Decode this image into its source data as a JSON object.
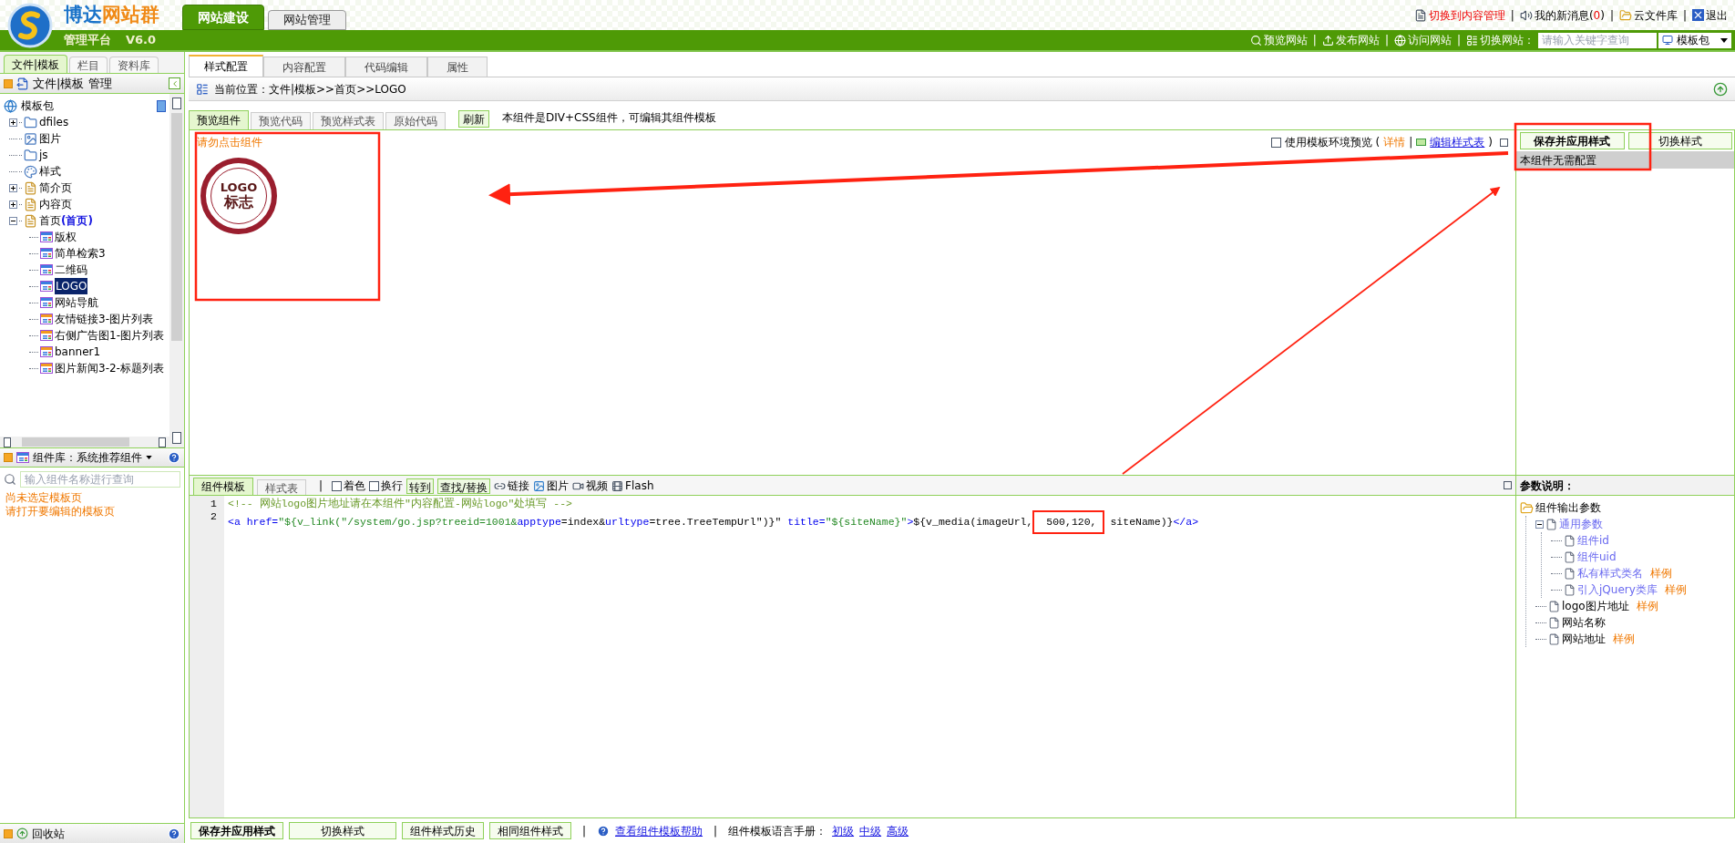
{
  "header": {
    "brand_parts": [
      "博达",
      "网站群"
    ],
    "subtitle": "管理平台",
    "version": "V6.0",
    "tabs": [
      {
        "label": "网站建设",
        "selected": true
      },
      {
        "label": "网站管理",
        "selected": false
      }
    ],
    "top_links": [
      {
        "kind": "alert",
        "label": "切换到内容管理"
      },
      {
        "kind": "sep",
        "label": "|"
      },
      {
        "kind": "messages",
        "label": "我的新消息",
        "open": "(",
        "count": "0",
        "close": ")"
      },
      {
        "kind": "sep",
        "label": "|"
      },
      {
        "kind": "cloud",
        "label": "云文件库"
      },
      {
        "kind": "sep",
        "label": "|"
      },
      {
        "kind": "exit",
        "label": "退出"
      }
    ],
    "actions": [
      {
        "kind": "preview",
        "label": "预览网站"
      },
      {
        "kind": "sep",
        "label": "|"
      },
      {
        "kind": "publish",
        "label": "发布网站"
      },
      {
        "kind": "sep",
        "label": "|"
      },
      {
        "kind": "visit",
        "label": "访问网站"
      },
      {
        "kind": "sep",
        "label": "|"
      },
      {
        "kind": "switch",
        "label": "切换网站："
      }
    ],
    "site_search": {
      "placeholder": "请输入关键字查询"
    },
    "site_select": {
      "value": "模板包"
    }
  },
  "left_panel": {
    "tabs": [
      {
        "label": "文件|模板",
        "selected": true
      },
      {
        "label": "栏目",
        "selected": false
      },
      {
        "label": "资料库",
        "selected": false
      }
    ],
    "title": "文件|模板 管理",
    "tree": {
      "root": {
        "label": "模板包"
      },
      "items": [
        {
          "label": "dfiles",
          "kind": "folder",
          "expanded": false
        },
        {
          "label": "图片",
          "kind": "image-folder"
        },
        {
          "label": "js",
          "kind": "folder"
        },
        {
          "label": "样式",
          "kind": "style-folder"
        },
        {
          "label": "简介页",
          "kind": "page",
          "expanded": false
        },
        {
          "label": "内容页",
          "kind": "page",
          "expanded": false
        },
        {
          "label": "首页",
          "tag": "(首页)",
          "kind": "page",
          "expanded": true,
          "children": [
            {
              "label": "版权",
              "kind": "component",
              "selected": false
            },
            {
              "label": "简单检索3",
              "kind": "component",
              "selected": false
            },
            {
              "label": "二维码",
              "kind": "component",
              "selected": false
            },
            {
              "label": "LOGO",
              "kind": "component",
              "selected": true
            },
            {
              "label": "网站导航",
              "kind": "component",
              "selected": false
            },
            {
              "label": "友情链接3-图片列表",
              "kind": "list-component",
              "selected": false
            },
            {
              "label": "右侧广告图1-图片列表",
              "kind": "list-component",
              "selected": false
            },
            {
              "label": "banner1",
              "kind": "list-component",
              "selected": false
            },
            {
              "label": "图片新闻3-2-标题列表",
              "kind": "list-component",
              "selected": false
            }
          ]
        }
      ]
    },
    "library": {
      "title": "组件库：系统推荐组件",
      "search": {
        "placeholder": "输入组件名称进行查询"
      },
      "messages": [
        "尚未选定模板页",
        "请打开要编辑的模板页"
      ]
    },
    "recycle": {
      "label": "回收站"
    }
  },
  "main": {
    "tabs": [
      {
        "label": "样式配置",
        "selected": true
      },
      {
        "label": "内容配置",
        "selected": false
      },
      {
        "label": "代码编辑",
        "selected": false
      },
      {
        "label": "属性",
        "selected": false
      }
    ],
    "breadcrumb": "当前位置：文件|模板>>首页>>LOGO",
    "preview_tabs": [
      {
        "label": "预览组件",
        "selected": true
      },
      {
        "label": "预览代码",
        "selected": false
      },
      {
        "label": "预览样式表",
        "selected": false
      },
      {
        "label": "原始代码",
        "selected": false
      }
    ],
    "refresh": "刷新",
    "info": "本组件是DIV+CSS组件，可编辑其组件模板",
    "preview": {
      "warning": "请勿点击组件",
      "env_option": {
        "label": "使用模板环境预览",
        "checked": false
      },
      "open": "(",
      "details": "详情",
      "sep": "|",
      "edit_styles": "编辑样式表",
      "close": ")",
      "logo": {
        "text": "LOGO",
        "subtext": "标志"
      }
    },
    "config_panel": {
      "buttons": [
        "保存并应用样式",
        "切换样式"
      ],
      "note": "本组件无需配置"
    },
    "editor": {
      "tabs": [
        {
          "label": "组件模板",
          "selected": true
        },
        {
          "label": "样式表",
          "selected": false
        }
      ],
      "sep": "|",
      "options": [
        {
          "label": "着色",
          "checked": false
        },
        {
          "label": "换行",
          "checked": false
        }
      ],
      "tools": [
        {
          "kind": "button",
          "label": "转到"
        },
        {
          "kind": "button",
          "label": "查找/替换"
        },
        {
          "kind": "link",
          "label": "链接"
        },
        {
          "kind": "image",
          "label": "图片"
        },
        {
          "kind": "video",
          "label": "视频"
        },
        {
          "kind": "flash",
          "label": "Flash"
        }
      ],
      "lines": [
        {
          "number": "1",
          "segments": [
            {
              "kind": "comment",
              "text": "<!-- 网站logo图片地址请在本组件\"内容配置-网站logo\"处填写 -->"
            }
          ]
        },
        {
          "number": "2",
          "segments": [
            {
              "kind": "tag",
              "text": "<a href="
            },
            {
              "kind": "string",
              "text": "\"${v_link(\"/system/go.jsp?treeid=1001&"
            },
            {
              "kind": "tag",
              "text": "apptype"
            },
            {
              "kind": "text",
              "text": "=index&"
            },
            {
              "kind": "tag",
              "text": "urltype"
            },
            {
              "kind": "text",
              "text": "=tree.TreeTempUrl\")}\""
            },
            {
              "kind": "tag",
              "text": " title="
            },
            {
              "kind": "string",
              "text": "\"${siteName}\""
            },
            {
              "kind": "tag",
              "text": ">"
            },
            {
              "kind": "text",
              "text": "${v_media(imageUrl,"
            },
            {
              "kind": "text",
              "text": " 500,120,",
              "highlighted": true
            },
            {
              "kind": "text",
              "text": " siteName)}"
            },
            {
              "kind": "tag",
              "text": "</a>"
            }
          ]
        }
      ]
    },
    "params": {
      "title": "参数说明：",
      "tree": [
        {
          "label": "组件输出参数",
          "kind": "folder",
          "children": [
            {
              "label": "通用参数",
              "kind": "group",
              "expanded": true,
              "children": [
                {
                  "label": "组件id",
                  "kind": "common"
                },
                {
                  "label": "组件uid",
                  "kind": "common"
                },
                {
                  "label": "私有样式类名",
                  "kind": "common",
                  "example": "样例"
                },
                {
                  "label": "引入jQuery类库",
                  "kind": "common",
                  "example": "样例"
                }
              ]
            },
            {
              "label": "logo图片地址",
              "kind": "param",
              "example": "样例"
            },
            {
              "label": "网站名称",
              "kind": "param"
            },
            {
              "label": "网站地址",
              "kind": "param",
              "example": "样例"
            }
          ]
        }
      ]
    },
    "footer": {
      "buttons": [
        "保存并应用样式",
        "切换样式",
        "组件样式历史",
        "相同组件样式"
      ],
      "sep": "|",
      "help": "查看组件模板帮助",
      "sep2": "|",
      "manual_label": "组件模板语言手册：",
      "levels": [
        "初级",
        "中级",
        "高级"
      ]
    }
  }
}
